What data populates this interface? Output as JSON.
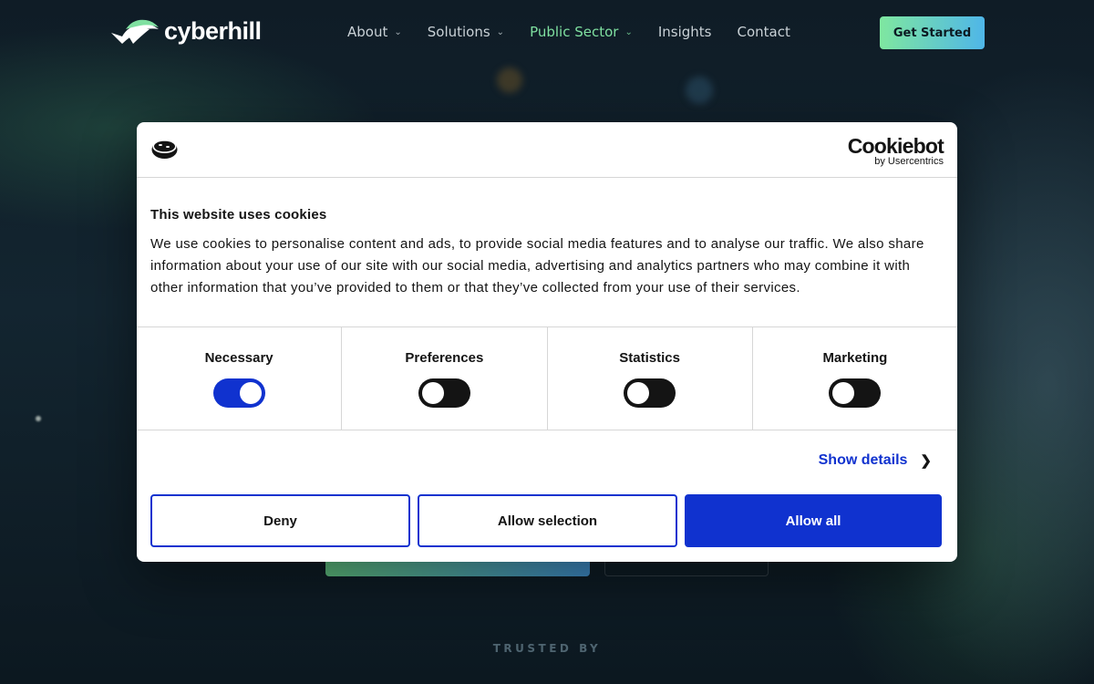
{
  "nav": {
    "logo_text": "cyberhill",
    "items": [
      {
        "label": "About",
        "has_dropdown": true,
        "active": false
      },
      {
        "label": "Solutions",
        "has_dropdown": true,
        "active": false
      },
      {
        "label": "Public Sector",
        "has_dropdown": true,
        "active": true
      },
      {
        "label": "Insights",
        "has_dropdown": false,
        "active": false
      },
      {
        "label": "Contact",
        "has_dropdown": false,
        "active": false
      }
    ],
    "cta_label": "Get Started"
  },
  "page": {
    "trusted_label": "TRUSTED BY"
  },
  "cookie_dialog": {
    "brand_name": "Cookiebot",
    "brand_sub": "by Usercentrics",
    "title": "This website uses cookies",
    "text": "We use cookies to personalise content and ads, to provide social media features and to analyse our traffic. We also share information about your use of our site with our social media, advertising and analytics partners who may combine it with other information that you’ve provided to them or that they’ve collected from your use of their services.",
    "categories": [
      {
        "label": "Necessary",
        "enabled": true
      },
      {
        "label": "Preferences",
        "enabled": false
      },
      {
        "label": "Statistics",
        "enabled": false
      },
      {
        "label": "Marketing",
        "enabled": false
      }
    ],
    "show_details_label": "Show details",
    "buttons": {
      "deny": "Deny",
      "allow_selection": "Allow selection",
      "allow_all": "Allow all"
    }
  },
  "colors": {
    "accent_blue": "#1032cf",
    "nav_active": "#7fe0a0",
    "cta_gradient_start": "#7fe7a0",
    "cta_gradient_end": "#4fb6e8"
  }
}
